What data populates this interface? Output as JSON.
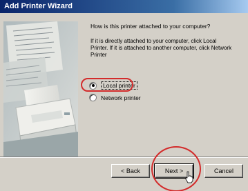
{
  "window": {
    "title": "Add Printer Wizard"
  },
  "page": {
    "question": "How is this printer attached to your computer?",
    "instructions": "If it is directly attached to your computer, click Local\nPrinter. If it is attached to another computer, click Network\nPrinter"
  },
  "options": [
    {
      "label": "Local printer",
      "selected": true
    },
    {
      "label": "Network printer",
      "selected": false
    }
  ],
  "buttons": {
    "back": "< Back",
    "next": "Next >",
    "cancel": "Cancel"
  },
  "colors": {
    "titlebar": "#0a246a",
    "dialog_bg": "#d4d0c8",
    "highlight": "#d32b2b"
  }
}
